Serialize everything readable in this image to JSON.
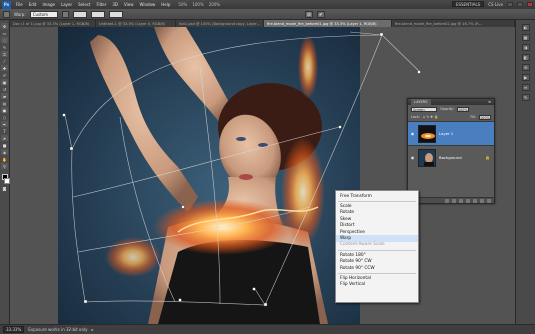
{
  "menubar": {
    "logo": "Ps",
    "items": [
      "File",
      "Edit",
      "Image",
      "Layer",
      "Select",
      "Filter",
      "3D",
      "View",
      "Window",
      "Help"
    ],
    "zoom_values": [
      "50%",
      "100%",
      "200%"
    ],
    "workspace": "ESSENTIALS",
    "cs_live": "CS Live"
  },
  "options": {
    "warp_label": "Warp:",
    "warp_value": "Custom",
    "cancel_symbol": "⊘",
    "commit_symbol": "✔"
  },
  "tabs": [
    "Doc (1 of 1).jpg @ 33.3% (Layer 1, RGB/8)",
    "Untitled-1 @ 33.3% (Layer 0, RGB/8)",
    "hot1.psd @ 100% (Background copy, Layer...",
    "fire.blend_mode_fire_before01.jpg @ 33.3% (Layer 1, RGB/8)",
    "fire.blend_mode_fire_before02.jpg @ 16.7% (R..."
  ],
  "layers_panel": {
    "title": "LAYERS",
    "blend_mode": "Screen",
    "opacity_label": "Opacity:",
    "opacity_value": "100%",
    "lock_label": "Lock:",
    "fill_label": "Fill:",
    "fill_value": "100%",
    "layers": [
      {
        "name": "Layer 1",
        "selected": true,
        "visible": true
      },
      {
        "name": "Background",
        "selected": false,
        "visible": true,
        "locked": true
      }
    ]
  },
  "context_menu": {
    "groups": [
      [
        "Free Transform"
      ],
      [
        "Scale",
        "Rotate",
        "Skew",
        "Distort",
        "Perspective",
        "Warp",
        "Content-Aware Scale"
      ],
      [
        "Rotate 180°",
        "Rotate 90° CW",
        "Rotate 90° CCW"
      ],
      [
        "Flip Horizontal",
        "Flip Vertical"
      ]
    ],
    "hovered": "Warp",
    "disabled": [
      "Content-Aware Scale"
    ]
  },
  "status": {
    "zoom": "33.33%",
    "info": "Exposure works in 32-bit only"
  },
  "colors": {
    "selection": "#4a7fbf",
    "menu_hover": "#cfe1f7",
    "canvas_bg": "#535353"
  }
}
